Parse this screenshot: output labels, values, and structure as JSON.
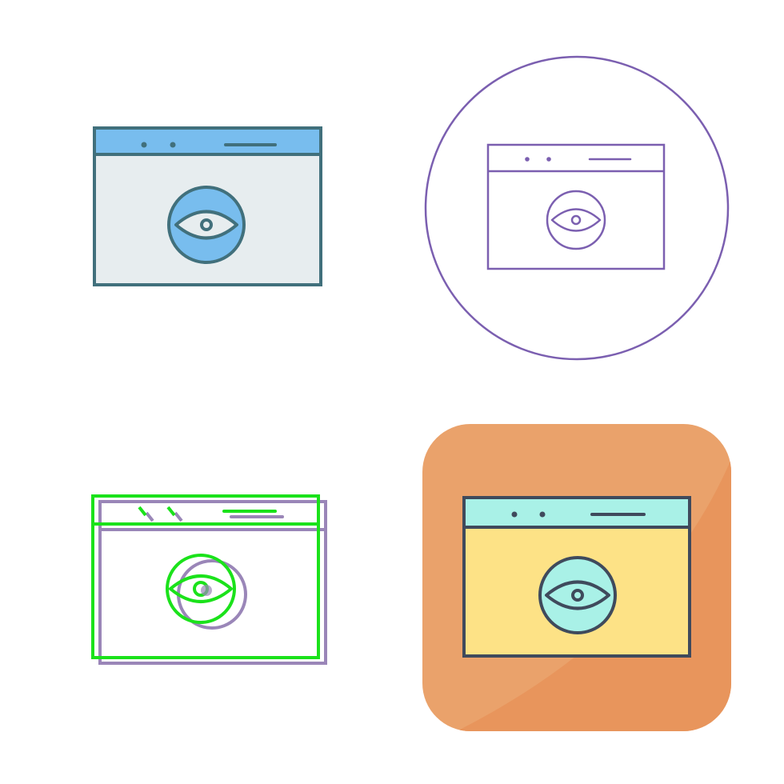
{
  "icons": [
    {
      "id": "filled",
      "style": "filled",
      "icon_name": "browser-eye-icon",
      "colors": {
        "stroke": "#41707c",
        "titlebar": "#78bdee",
        "body": "#e7edef",
        "eye_disc": "#78bdee",
        "eye_white": "#e7edef"
      }
    },
    {
      "id": "outline-circle",
      "style": "outline-in-circle",
      "icon_name": "browser-eye-icon",
      "colors": {
        "stroke": "#7b5fb0",
        "background": "#ffffff"
      }
    },
    {
      "id": "lined",
      "style": "green-offset-outline",
      "icon_name": "browser-eye-icon",
      "colors": {
        "primary": "#1be21b",
        "shadow": "#9a86b8"
      }
    },
    {
      "id": "flat-tile",
      "style": "flat-on-rounded-square",
      "icon_name": "browser-eye-icon",
      "colors": {
        "tile": "#eaa26b",
        "tile_shade": "#e8955c",
        "stroke": "#3f4a5c",
        "titlebar": "#a9f1e7",
        "body": "#fde286",
        "eye_disc": "#a9f1e7",
        "eye_white": "#a9f1e7"
      }
    }
  ]
}
